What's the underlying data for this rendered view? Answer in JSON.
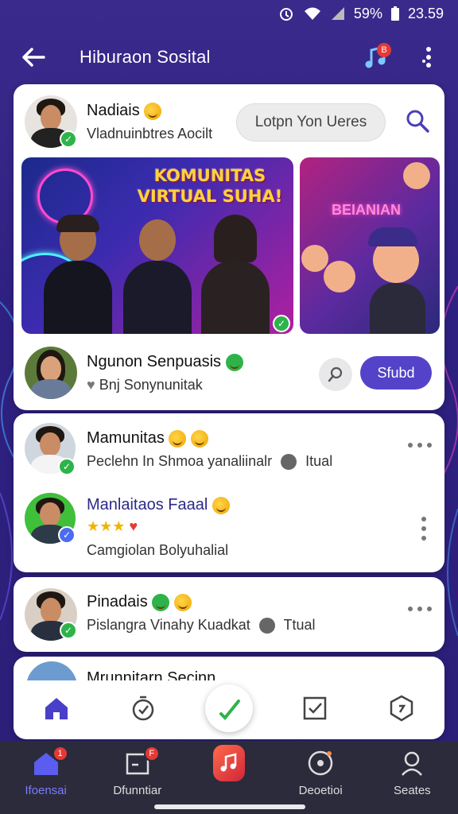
{
  "status_bar": {
    "battery": "59%",
    "time": "23.59"
  },
  "app_bar": {
    "title": "Hiburaon Sosital",
    "music_badge": "B"
  },
  "profile_header": {
    "name": "Nadiais",
    "subtitle": "Vladnuinbtres Aocilt",
    "action_pill": "Lotpn Yon Ueres"
  },
  "banner": {
    "title": "KOMUNITAS VIRTUAL SUHA!",
    "side_sign": "BEIANIAN"
  },
  "follow_row": {
    "name": "Ngunon Senpuasis",
    "subtitle": "Bnj Sonynunitak",
    "follow_label": "Sfubd"
  },
  "list_items": [
    {
      "name": "Mamunitas",
      "subtitle": "Peclehn In Shmoa yanaliinalr",
      "tag": "Itual"
    },
    {
      "name": "Manlaitaos Faaal",
      "rating": "★★★",
      "subtitle": "Camgiolan Bolyuhalial"
    }
  ],
  "post": {
    "name": "Pinadais",
    "subtitle": "Pislangra Vinahy Kuadkat",
    "tag": "Ttual"
  },
  "peek": {
    "name": "Mrunnitarn Secinn"
  },
  "bottom_nav": [
    {
      "label": "Ifoensai",
      "badge": "1"
    },
    {
      "label": "Dfunntiar",
      "badge": "F"
    },
    {
      "label": ""
    },
    {
      "label": "Deoetioi"
    },
    {
      "label": "Seates"
    }
  ],
  "colors": {
    "accent": "#5443c9",
    "verified": "#2eb34a",
    "badge": "#e53935"
  }
}
